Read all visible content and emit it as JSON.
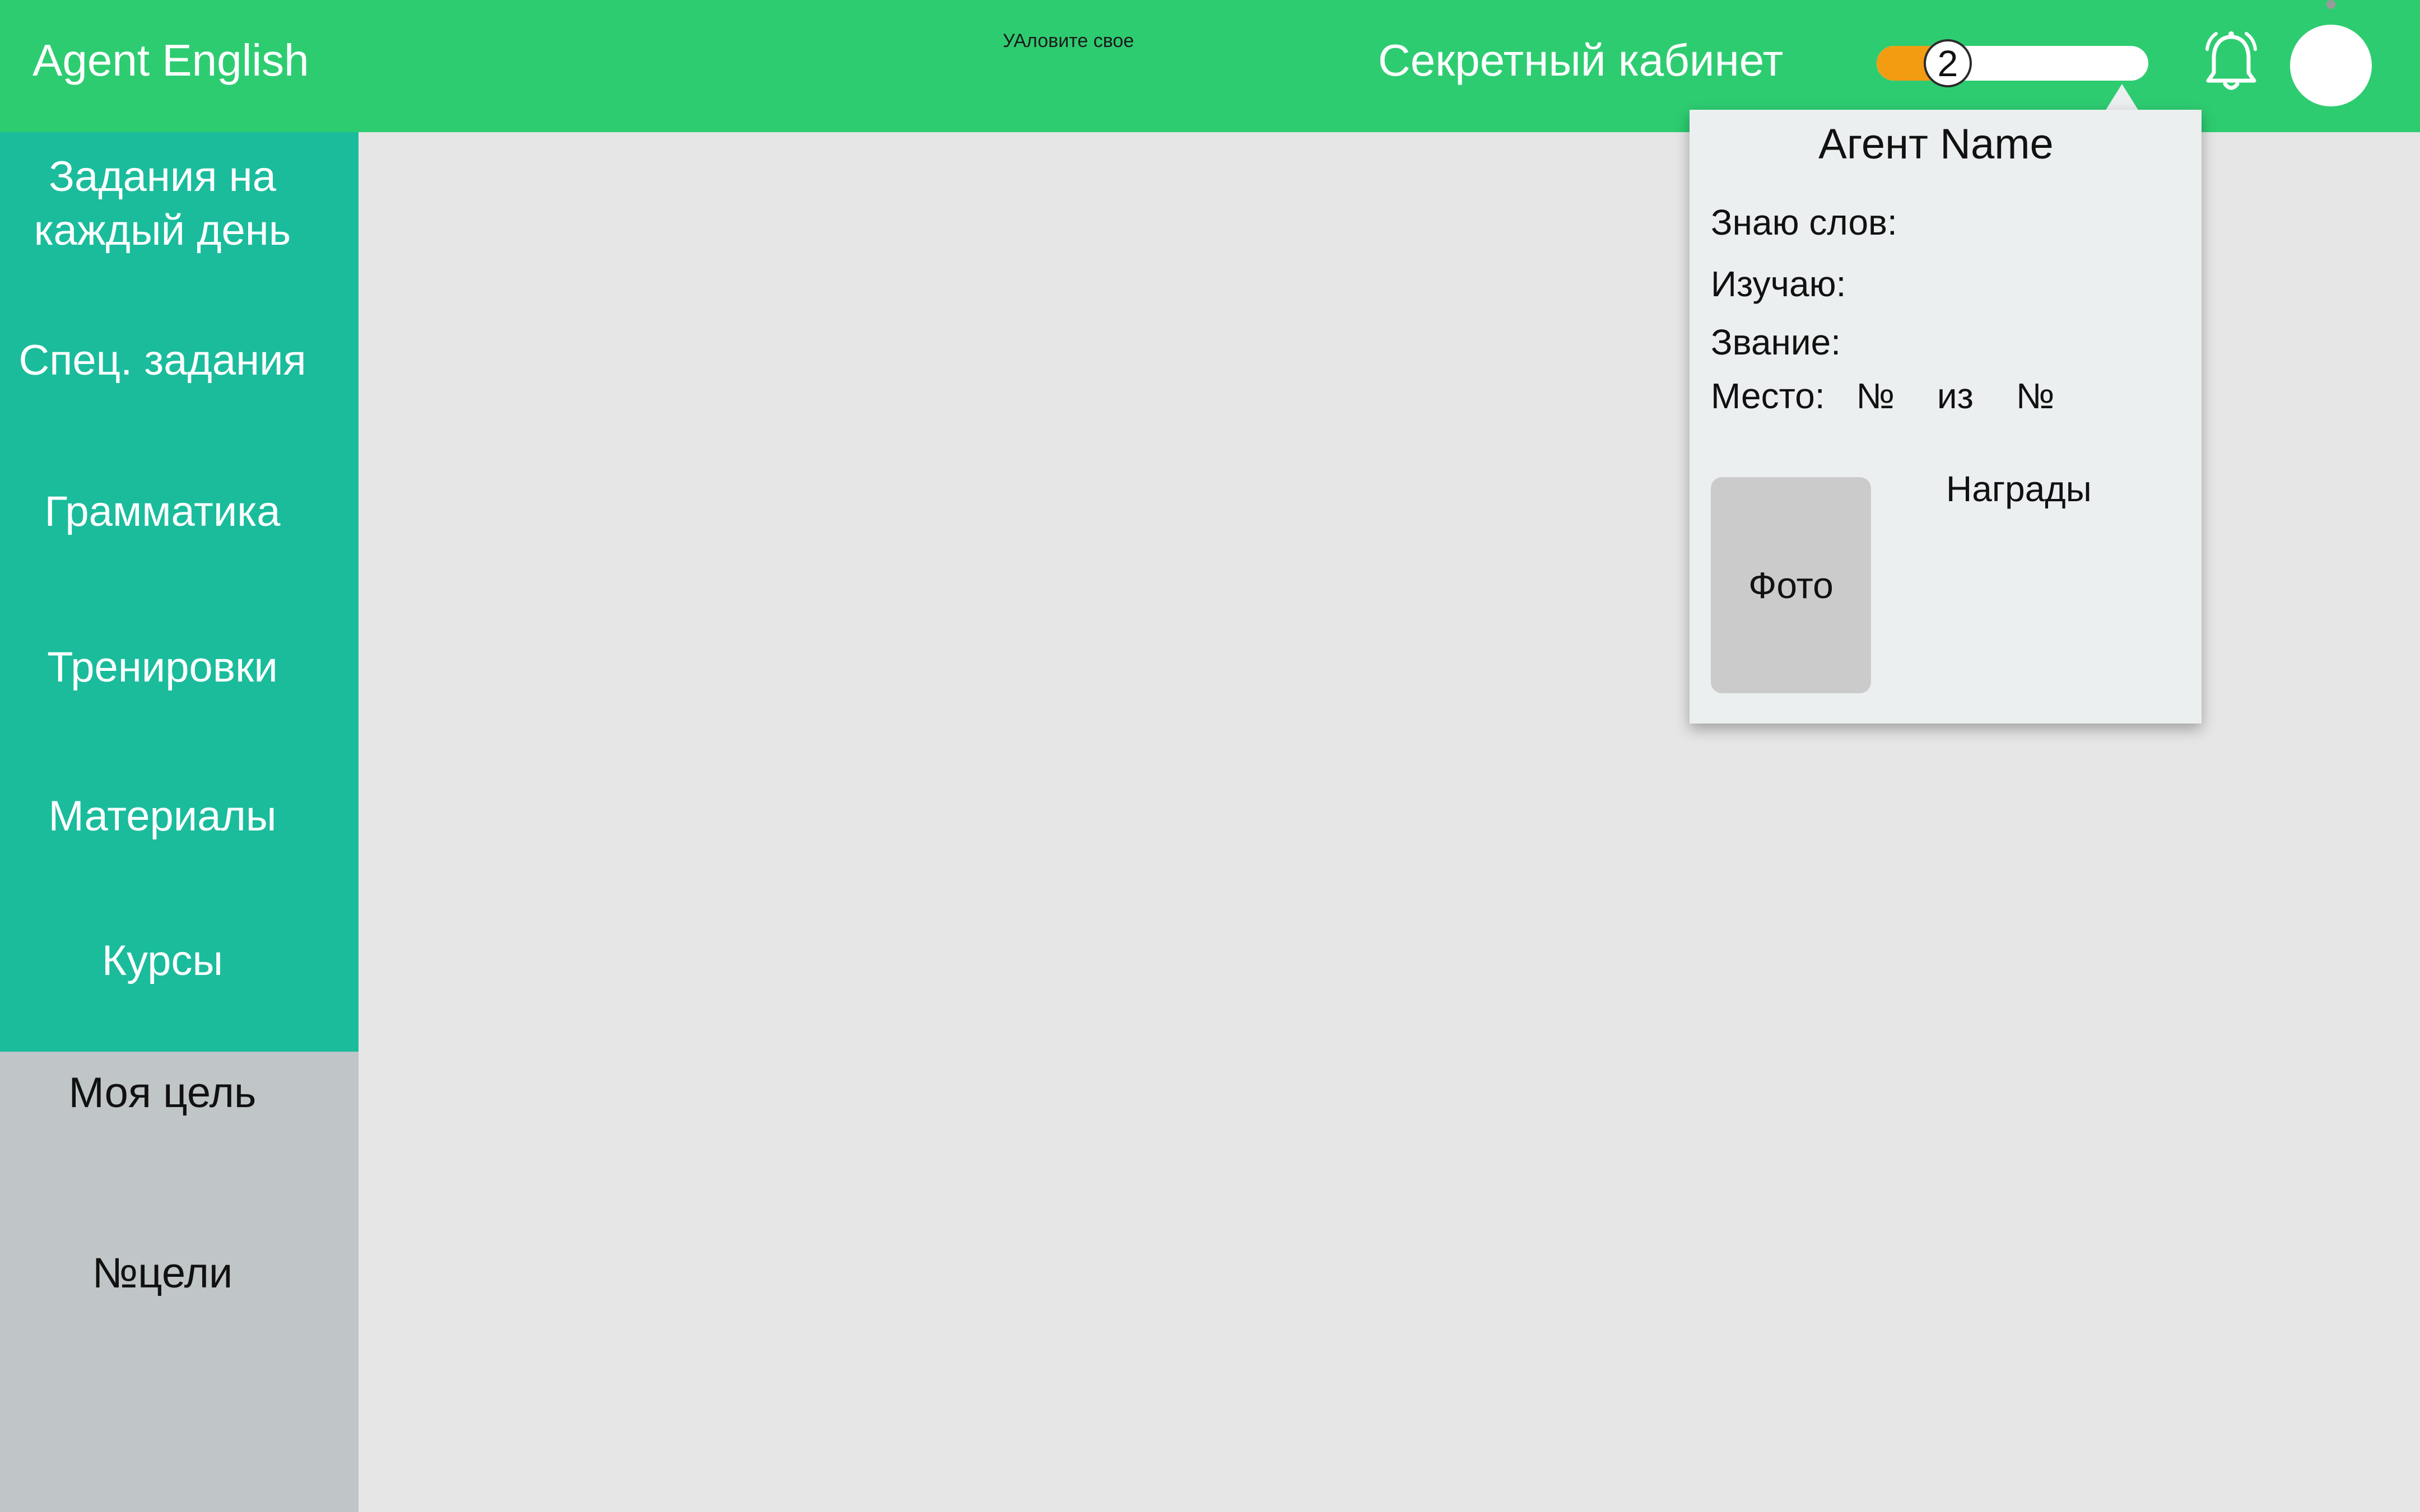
{
  "header": {
    "app_title": "Agent English",
    "tiny_caption": "УАловите свое",
    "cabinet_title": "Секретный кабинет",
    "level": "2",
    "progress_fraction": 0.2
  },
  "sidebar": {
    "items": [
      {
        "line1": "Задания на",
        "line2": "каждый день"
      },
      {
        "label": "Спец. задания"
      },
      {
        "label": "Грамматика"
      },
      {
        "label": "Тренировки"
      },
      {
        "label": "Материалы"
      },
      {
        "label": "Курсы"
      }
    ],
    "goal_label": "Моя цель",
    "goal_number": "№цели"
  },
  "profile": {
    "name": "Агент Name",
    "known_words_label": "Знаю слов:",
    "studying_label": "Изучаю:",
    "rank_label": "Звание:",
    "place_label": "Место:",
    "place_num1": "№",
    "place_of": "из",
    "place_num2": "№",
    "photo_label": "Фото",
    "awards_label": "Награды"
  },
  "colors": {
    "header": "#2ecc71",
    "nav": "#1abc9c",
    "goal_panel": "#c0c5c8",
    "progress": "#f39c12"
  }
}
